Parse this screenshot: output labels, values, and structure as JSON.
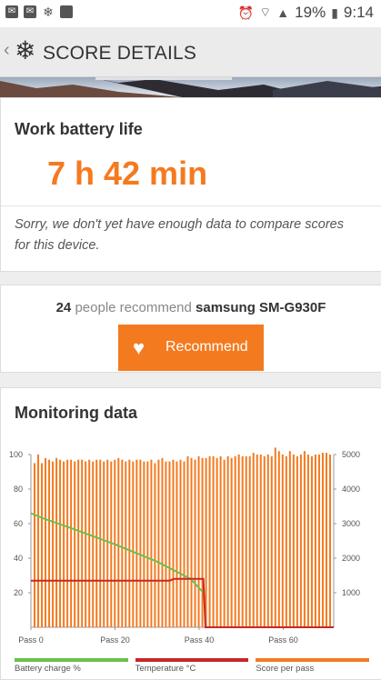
{
  "status": {
    "battery": "19%",
    "time": "9:14"
  },
  "toolbar": {
    "title": "SCORE DETAILS"
  },
  "battery_card": {
    "title": "Work battery life",
    "value": "7 h 42 min",
    "message": "Sorry, we don't yet have enough data to compare scores for this device."
  },
  "recommend_card": {
    "count": "24",
    "middle_text": " people recommend ",
    "device": "samsung SM-G930F",
    "button_label": "Recommend"
  },
  "monitoring": {
    "title": "Monitoring data"
  },
  "colors": {
    "accent": "#f47a20",
    "battery": "#6cc04a",
    "temperature": "#c62828",
    "score": "#f47a20"
  },
  "chart_data": {
    "type": "bar",
    "x_ticks": [
      "Pass 0",
      "Pass 20",
      "Pass 40",
      "Pass 60"
    ],
    "y_left_ticks": [
      "100",
      "80",
      "60",
      "40",
      "20"
    ],
    "y_right_ticks": [
      "5000",
      "4000",
      "3000",
      "2000",
      "1000"
    ],
    "ylim_left": [
      0,
      100
    ],
    "ylim_right": [
      0,
      5000
    ],
    "x_range": [
      0,
      72
    ],
    "legend": [
      "Battery charge %",
      "Temperature °C",
      "Score per pass"
    ],
    "series": [
      {
        "name": "Score per pass",
        "type": "bar",
        "axis": "right",
        "values": [
          4750,
          5000,
          4750,
          4900,
          4850,
          4800,
          4900,
          4850,
          4800,
          4850,
          4850,
          4800,
          4850,
          4850,
          4800,
          4850,
          4800,
          4850,
          4850,
          4800,
          4850,
          4800,
          4850,
          4900,
          4850,
          4800,
          4850,
          4800,
          4850,
          4850,
          4800,
          4800,
          4850,
          4750,
          4850,
          4900,
          4800,
          4800,
          4850,
          4800,
          4850,
          4800,
          4950,
          4900,
          4850,
          4950,
          4900,
          4900,
          4950,
          4950,
          4900,
          4950,
          4850,
          4950,
          4900,
          4950,
          5000,
          4950,
          4950,
          4950,
          5050,
          5000,
          5000,
          4950,
          5000,
          4950,
          5200,
          5100,
          5000,
          4950,
          5100,
          5000,
          4950,
          5000,
          5100,
          5000,
          4950,
          5000,
          5000,
          5050,
          5050,
          5000
        ]
      },
      {
        "name": "Battery charge %",
        "type": "line",
        "axis": "left",
        "x": [
          0,
          3,
          10,
          20,
          30,
          38,
          41
        ],
        "values": [
          66,
          63,
          57,
          48,
          38,
          28,
          20
        ]
      },
      {
        "name": "Temperature °C",
        "type": "line",
        "axis": "left",
        "x": [
          0,
          10,
          20,
          33,
          34,
          41,
          41.5,
          72
        ],
        "values": [
          27,
          27,
          27,
          27,
          28,
          28,
          0,
          0
        ]
      }
    ]
  }
}
